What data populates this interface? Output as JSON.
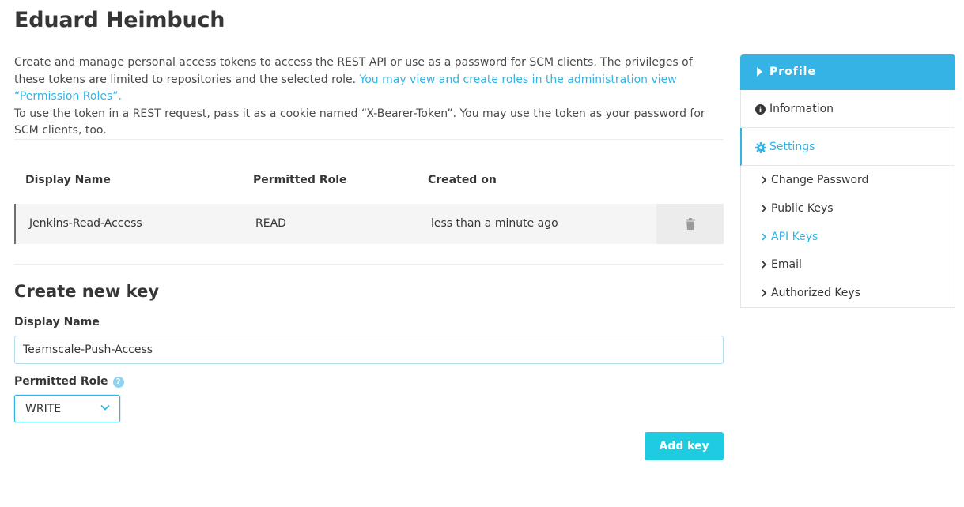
{
  "page": {
    "title": "Eduard Heimbuch",
    "intro_text_1": "Create and manage personal access tokens to access the REST API or use as a password for SCM clients. The privileges of these tokens are limited to repositories and the selected role. ",
    "intro_link": "You may view and create roles in the administration view “Permission Roles”.",
    "intro_text_2": "To use the token in a REST request, pass it as a cookie named “X-Bearer-Token”. You may use the token as your password for SCM clients, too."
  },
  "table": {
    "headers": [
      "Display Name",
      "Permitted Role",
      "Created on"
    ],
    "rows": [
      {
        "display_name": "Jenkins-Read-Access",
        "role": "READ",
        "created": "less than a minute ago",
        "action_icon": "trash-icon"
      }
    ]
  },
  "create": {
    "title": "Create new key",
    "display_name_label": "Display Name",
    "display_name_value": "Teamscale-Push-Access",
    "role_label": "Permitted Role",
    "help_icon": "question-circle-icon",
    "role_value": "WRITE",
    "add_button": "Add key"
  },
  "sidebar": {
    "header": "Profile",
    "information": "Information",
    "settings": "Settings",
    "items": [
      {
        "label": "Change Password",
        "active": false
      },
      {
        "label": "Public Keys",
        "active": false
      },
      {
        "label": "API Keys",
        "active": true
      },
      {
        "label": "Email",
        "active": false
      },
      {
        "label": "Authorized Keys",
        "active": false
      }
    ]
  },
  "colors": {
    "accent": "#33b2e3",
    "button": "#1fcbe0",
    "sidebar_header": "#35b3e5"
  }
}
